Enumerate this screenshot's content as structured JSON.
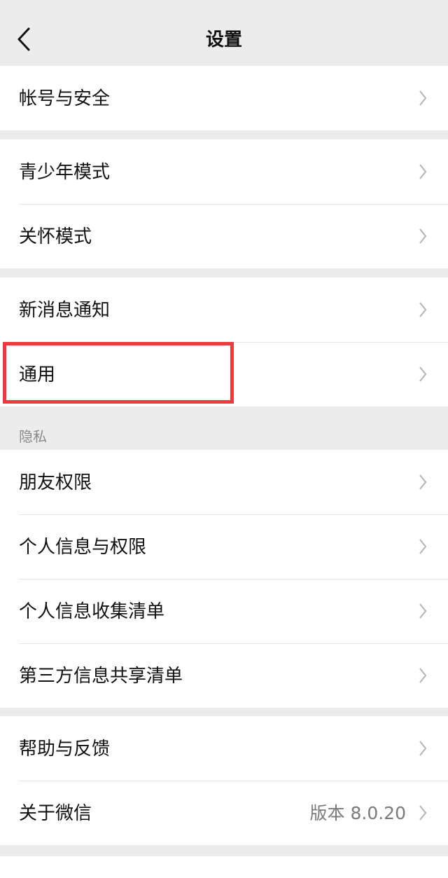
{
  "header": {
    "title": "设置"
  },
  "groups": [
    {
      "items": [
        {
          "label": "帐号与安全"
        }
      ]
    },
    {
      "items": [
        {
          "label": "青少年模式"
        },
        {
          "label": "关怀模式"
        }
      ]
    },
    {
      "items": [
        {
          "label": "新消息通知"
        },
        {
          "label": "通用"
        }
      ]
    },
    {
      "section_label": "隐私",
      "items": [
        {
          "label": "朋友权限"
        },
        {
          "label": "个人信息与权限"
        },
        {
          "label": "个人信息收集清单"
        },
        {
          "label": "第三方信息共享清单"
        }
      ]
    },
    {
      "items": [
        {
          "label": "帮助与反馈"
        },
        {
          "label": "关于微信",
          "value": "版本 8.0.20"
        }
      ]
    }
  ],
  "colors": {
    "highlight": "#ec3b3b",
    "background": "#ececec",
    "row_bg": "#ffffff"
  }
}
